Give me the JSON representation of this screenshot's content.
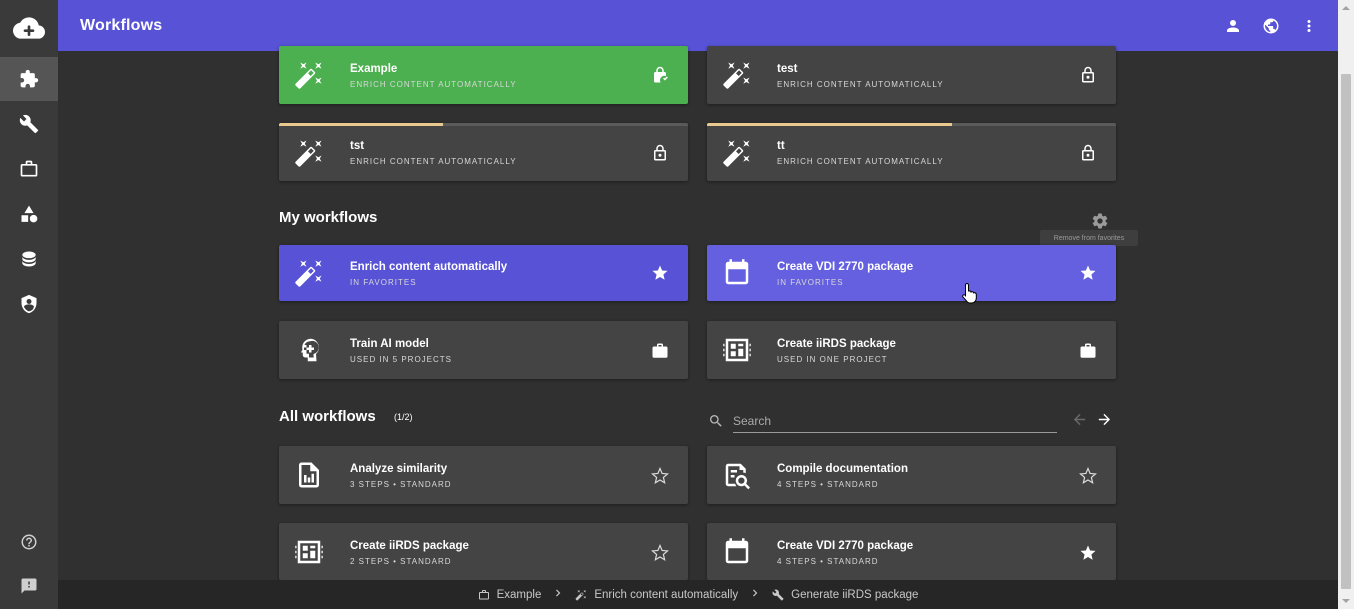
{
  "app": {
    "title": "Workflows"
  },
  "colors": {
    "accent": "#5752d6",
    "success": "#4caf50",
    "progress": "#e9c98d"
  },
  "sidebar": {
    "items": [
      {
        "icon": "puzzle-icon",
        "active": true
      },
      {
        "icon": "wrench-icon"
      },
      {
        "icon": "briefcase-icon"
      },
      {
        "icon": "shapes-icon"
      },
      {
        "icon": "database-icon"
      },
      {
        "icon": "shield-account-icon"
      }
    ],
    "bottom": [
      {
        "icon": "help-circle-icon"
      },
      {
        "icon": "feedback-icon"
      }
    ]
  },
  "running": [
    {
      "name": "Example",
      "sub": "Enrich content automatically",
      "icon": "magic-wand-icon",
      "action_icon": "lock-check-icon"
    },
    {
      "name": "test",
      "sub": "Enrich content automatically",
      "icon": "magic-wand-icon",
      "action_icon": "lock-icon"
    },
    {
      "name": "tst",
      "sub": "Enrich content automatically",
      "icon": "magic-wand-icon",
      "action_icon": "lock-icon",
      "progress": 0.4
    },
    {
      "name": "tt",
      "sub": "Enrich content automatically",
      "icon": "magic-wand-icon",
      "action_icon": "lock-icon",
      "progress": 0.6
    }
  ],
  "my_workflows": {
    "title": "My workflows",
    "tooltip": "Remove from favorites",
    "items": [
      {
        "name": "Enrich content automatically",
        "sub": "In favorites",
        "icon": "magic-wand-icon",
        "action_icon": "star-icon"
      },
      {
        "name": "Create VDI 2770 package",
        "sub": "In favorites",
        "icon": "calendar-box-icon",
        "action_icon": "star-icon"
      },
      {
        "name": "Train AI model",
        "sub": "Used in 5 projects",
        "icon": "brain-icon",
        "action_icon": "briefcase-icon"
      },
      {
        "name": "Create iiRDS package",
        "sub": "Used in one project",
        "icon": "iirds-package-icon",
        "action_icon": "briefcase-icon"
      }
    ]
  },
  "all_workflows": {
    "title": "All workflows",
    "count": "(1/2)",
    "search_placeholder": "Search",
    "items": [
      {
        "name": "Analyze similarity",
        "sub": "3 steps • standard",
        "icon": "file-chart-icon",
        "action_icon": "star-outline-icon"
      },
      {
        "name": "Compile documentation",
        "sub": "4 steps • standard",
        "icon": "file-search-icon",
        "action_icon": "star-outline-icon"
      },
      {
        "name": "Create iiRDS package",
        "sub": "2 steps • standard",
        "icon": "iirds-package-icon",
        "action_icon": "star-outline-icon"
      },
      {
        "name": "Create VDI 2770 package",
        "sub": "4 steps • standard",
        "icon": "calendar-box-icon",
        "action_icon": "star-icon"
      }
    ]
  },
  "breadcrumb": [
    {
      "label": "Example",
      "icon": "briefcase-icon"
    },
    {
      "label": "Enrich content automatically",
      "icon": "magic-wand-icon"
    },
    {
      "label": "Generate iiRDS package",
      "icon": "wrench-icon"
    }
  ]
}
